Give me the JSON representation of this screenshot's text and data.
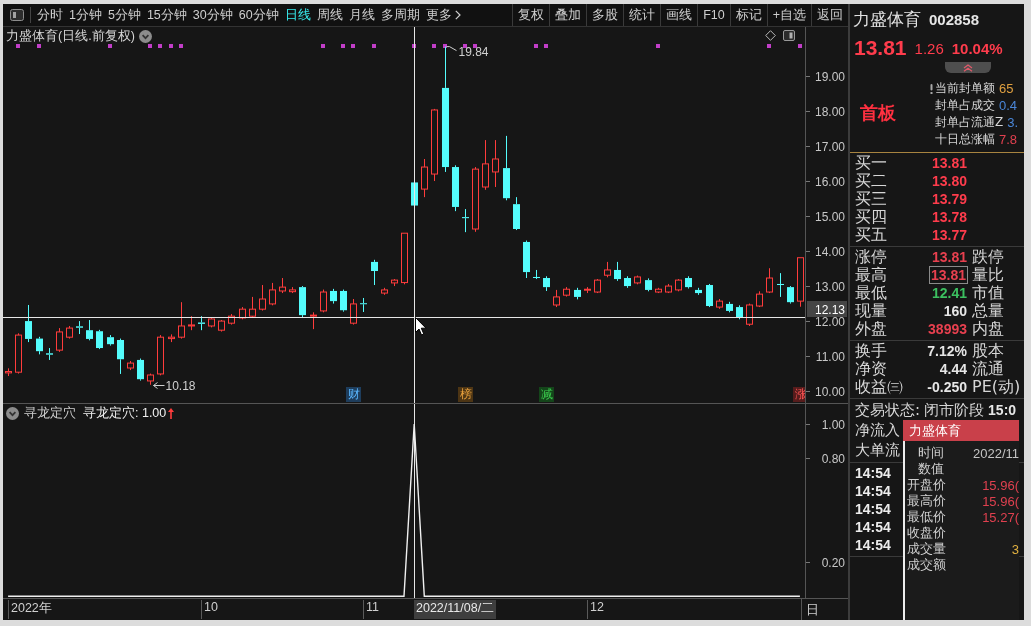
{
  "toolbar": {
    "periods": [
      {
        "label": "分时",
        "selected": false
      },
      {
        "label": "1分钟",
        "selected": false
      },
      {
        "label": "5分钟",
        "selected": false
      },
      {
        "label": "15分钟",
        "selected": false
      },
      {
        "label": "30分钟",
        "selected": false
      },
      {
        "label": "60分钟",
        "selected": false
      },
      {
        "label": "日线",
        "selected": true
      },
      {
        "label": "周线",
        "selected": false
      },
      {
        "label": "月线",
        "selected": false
      },
      {
        "label": "多周期",
        "selected": false
      }
    ],
    "more": "更多",
    "actions": [
      "复权",
      "叠加",
      "多股",
      "统计",
      "画线",
      "F10",
      "标记",
      "+自选",
      "返回"
    ]
  },
  "price_chart": {
    "title": "力盛体育(日线.前复权)",
    "chart_data": [
      {
        "type": "candlestick",
        "ylim": [
          9.66,
          20.4
        ],
        "yticks": [
          {
            "value": 19,
            "label": "19.00"
          },
          {
            "value": 18,
            "label": "18.00"
          },
          {
            "value": 17,
            "label": "17.00"
          },
          {
            "value": 16,
            "label": "16.00"
          },
          {
            "value": 15,
            "label": "15.00"
          },
          {
            "value": 14,
            "label": "14.00"
          },
          {
            "value": 13,
            "label": "13.00"
          },
          {
            "value": 12,
            "label": "12.00"
          },
          {
            "value": 11,
            "label": "11.00"
          },
          {
            "value": 10,
            "label": "10.00"
          }
        ],
        "ohlc": [
          [
            10.52,
            10.65,
            10.43,
            10.56
          ],
          [
            10.54,
            11.65,
            10.5,
            11.6
          ],
          [
            12.0,
            12.46,
            11.4,
            11.49
          ],
          [
            11.5,
            11.55,
            11.05,
            11.14
          ],
          [
            11.08,
            11.23,
            10.89,
            11.04
          ],
          [
            11.17,
            11.8,
            11.12,
            11.69
          ],
          [
            11.54,
            11.86,
            11.5,
            11.8
          ],
          [
            11.85,
            12.0,
            11.63,
            11.81
          ],
          [
            11.74,
            12.03,
            11.45,
            11.49
          ],
          [
            11.71,
            11.75,
            11.2,
            11.23
          ],
          [
            11.54,
            11.6,
            11.3,
            11.34
          ],
          [
            11.46,
            11.5,
            10.49,
            10.91
          ],
          [
            10.66,
            10.86,
            10.6,
            10.8
          ],
          [
            10.89,
            10.93,
            10.3,
            10.34
          ],
          [
            10.29,
            10.5,
            10.18,
            10.46
          ],
          [
            10.49,
            11.6,
            10.45,
            11.54
          ],
          [
            11.5,
            11.62,
            11.4,
            11.54
          ],
          [
            11.54,
            12.54,
            11.5,
            11.86
          ],
          [
            11.86,
            12.14,
            11.74,
            11.89
          ],
          [
            11.96,
            12.14,
            11.74,
            11.92
          ],
          [
            11.86,
            12.1,
            11.82,
            12.06
          ],
          [
            11.74,
            12.03,
            11.7,
            12.0
          ],
          [
            11.94,
            12.2,
            11.9,
            12.14
          ],
          [
            12.09,
            12.4,
            12.05,
            12.34
          ],
          [
            12.14,
            12.69,
            12.1,
            12.34
          ],
          [
            12.34,
            13.03,
            12.3,
            12.63
          ],
          [
            12.49,
            13.09,
            12.45,
            12.89
          ],
          [
            12.86,
            13.23,
            12.8,
            12.97
          ],
          [
            12.84,
            12.97,
            12.8,
            12.89
          ],
          [
            12.97,
            13.0,
            12.1,
            12.17
          ],
          [
            12.15,
            12.25,
            11.77,
            12.17
          ],
          [
            12.29,
            12.9,
            12.25,
            12.83
          ],
          [
            12.86,
            12.92,
            12.5,
            12.57
          ],
          [
            12.86,
            12.9,
            12.27,
            12.31
          ],
          [
            11.94,
            12.63,
            11.9,
            12.49
          ],
          [
            12.51,
            12.66,
            12.26,
            12.49
          ],
          [
            13.69,
            13.75,
            13.03,
            13.43
          ],
          [
            12.8,
            12.95,
            12.75,
            12.89
          ],
          [
            13.09,
            13.2,
            13.0,
            13.17
          ],
          [
            13.1,
            14.51,
            13.05,
            14.51
          ],
          [
            15.96,
            15.96,
            15.27,
            15.3
          ],
          [
            15.77,
            16.63,
            15.54,
            16.4
          ],
          [
            16.2,
            18.06,
            16.0,
            18.03
          ],
          [
            18.66,
            19.84,
            16.26,
            16.4
          ],
          [
            16.4,
            16.45,
            15.14,
            15.26
          ],
          [
            14.97,
            15.2,
            14.54,
            14.94
          ],
          [
            14.63,
            16.4,
            14.55,
            16.34
          ],
          [
            15.83,
            17.17,
            15.75,
            16.49
          ],
          [
            16.26,
            17.17,
            15.83,
            16.63
          ],
          [
            16.37,
            17.29,
            15.45,
            15.51
          ],
          [
            15.34,
            15.54,
            14.6,
            14.63
          ],
          [
            14.26,
            14.3,
            13.23,
            13.4
          ],
          [
            13.26,
            13.46,
            13.2,
            13.23
          ],
          [
            13.23,
            13.28,
            12.86,
            12.97
          ],
          [
            12.46,
            12.89,
            12.4,
            12.69
          ],
          [
            12.74,
            12.97,
            12.7,
            12.91
          ],
          [
            12.89,
            12.95,
            12.62,
            12.69
          ],
          [
            12.89,
            12.97,
            12.8,
            12.91
          ],
          [
            12.83,
            13.2,
            12.8,
            13.17
          ],
          [
            13.31,
            13.69,
            13.25,
            13.46
          ],
          [
            13.46,
            13.69,
            13.15,
            13.2
          ],
          [
            13.23,
            13.28,
            12.95,
            13.0
          ],
          [
            13.09,
            13.3,
            13.05,
            13.26
          ],
          [
            13.17,
            13.22,
            12.85,
            12.89
          ],
          [
            12.83,
            12.95,
            12.8,
            12.91
          ],
          [
            12.83,
            13.06,
            12.8,
            13.0
          ],
          [
            12.89,
            13.2,
            12.85,
            13.17
          ],
          [
            13.23,
            13.28,
            12.93,
            12.97
          ],
          [
            12.89,
            12.95,
            12.75,
            12.8
          ],
          [
            13.03,
            13.06,
            12.4,
            12.43
          ],
          [
            12.4,
            12.63,
            12.35,
            12.57
          ],
          [
            12.49,
            12.55,
            12.25,
            12.29
          ],
          [
            12.4,
            12.45,
            12.05,
            12.11
          ],
          [
            11.91,
            12.5,
            11.86,
            12.46
          ],
          [
            12.43,
            12.85,
            12.4,
            12.77
          ],
          [
            12.83,
            13.51,
            12.8,
            13.23
          ],
          [
            13.06,
            13.37,
            12.69,
            13.03
          ],
          [
            12.97,
            13.0,
            12.5,
            12.54
          ],
          [
            12.57,
            13.81,
            12.41,
            13.81
          ]
        ],
        "series": [
          {
            "type": "scatter",
            "marker": "square",
            "color": "#c23ec8",
            "values": [
              null,
              19.87,
              null,
              19.87,
              null,
              null,
              null,
              null,
              null,
              null,
              19.87,
              null,
              null,
              null,
              19.87,
              19.87,
              19.87,
              19.87,
              null,
              null,
              null,
              null,
              null,
              null,
              null,
              null,
              null,
              null,
              null,
              null,
              null,
              19.87,
              null,
              19.87,
              19.87,
              null,
              19.87,
              null,
              null,
              null,
              19.87,
              null,
              19.87,
              19.87,
              null,
              19.87,
              19.87,
              null,
              null,
              null,
              null,
              null,
              19.87,
              19.87,
              null,
              null,
              null,
              null,
              null,
              null,
              null,
              null,
              null,
              null,
              19.87,
              null,
              null,
              null,
              null,
              null,
              null,
              null,
              null,
              null,
              null,
              19.87,
              null,
              null,
              19.87
            ]
          }
        ],
        "annotations": [
          "19.84",
          "10.18"
        ],
        "ref_lines": [
          {
            "axis": "y",
            "value": 12.13,
            "label": "12.13"
          }
        ]
      }
    ],
    "events": [
      {
        "label": "财",
        "color": "#1e3d5c"
      },
      {
        "label": "榜",
        "color": "#4d3514"
      },
      {
        "label": "减",
        "color": "#14451a"
      },
      {
        "label": "涨",
        "color": "#561c1c"
      }
    ]
  },
  "indicator": {
    "name": "寻龙定穴",
    "reading": "寻龙定穴: 1.00",
    "chart_data": [
      {
        "type": "line",
        "ylim": [
          -0.01,
          1.116
        ],
        "yticks": [
          {
            "value": 1,
            "label": "1.00"
          },
          {
            "value": 0.8,
            "label": "0.80"
          },
          {
            "value": 0.2,
            "label": "0.20"
          }
        ],
        "values": [
          0,
          0,
          0,
          0,
          0,
          0,
          0,
          0,
          0,
          0,
          0,
          0,
          0,
          0,
          0,
          0,
          0,
          0,
          0,
          0,
          0,
          0,
          0,
          0,
          0,
          0,
          0,
          0,
          0,
          0,
          0,
          0,
          0,
          0,
          0,
          0,
          0,
          0,
          0,
          0,
          1,
          0,
          0,
          0,
          0,
          0,
          0,
          0,
          0,
          0,
          0,
          0,
          0,
          0,
          0,
          0,
          0,
          0,
          0,
          0,
          0,
          0,
          0,
          0,
          0,
          0,
          0,
          0,
          0,
          0,
          0,
          0,
          0,
          0,
          0,
          0,
          0,
          0,
          0
        ],
        "color": "#f0f0f0"
      }
    ]
  },
  "date_axis": {
    "labels": [
      "2022年",
      "10",
      "11",
      "12"
    ],
    "cursor_label": "2022/11/08/二",
    "corner": "日"
  },
  "quote_panel": {
    "name": "力盛体育",
    "code": "002858",
    "price": "13.81",
    "change": "1.26",
    "change_pct": "10.04%",
    "board": "首板",
    "seal": [
      {
        "label": "当前封单额",
        "value": "65",
        "color": "#e0a040"
      },
      {
        "label": "封单占成交",
        "value": "0.4",
        "color": "#4a86d8"
      },
      {
        "label": "封单占流通Z",
        "value": "3.",
        "color": "#4a86d8"
      },
      {
        "label": "十日总涨幅",
        "value": "7.8",
        "color": "#e0404f"
      }
    ],
    "bids": [
      {
        "label": "买一",
        "price": "13.81"
      },
      {
        "label": "买二",
        "price": "13.80"
      },
      {
        "label": "买三",
        "price": "13.79"
      },
      {
        "label": "买四",
        "price": "13.78"
      },
      {
        "label": "买五",
        "price": "13.77"
      }
    ],
    "stats": [
      {
        "label": "涨停",
        "value": "13.81",
        "color": "#e8404f",
        "label2": "跌停",
        "highlighted": false
      },
      {
        "label": "最高",
        "value": "13.81",
        "color": "#e8404f",
        "label2": "量比",
        "highlighted": true
      },
      {
        "label": "最低",
        "value": "12.41",
        "color": "#3cc060",
        "label2": "市值",
        "highlighted": false
      },
      {
        "label": "现量",
        "value": "160",
        "color": "#e6e6e6",
        "label2": "总量",
        "highlighted": false
      },
      {
        "label": "外盘",
        "value": "38993",
        "color": "#e8404f",
        "label2": "内盘",
        "highlighted": false
      }
    ],
    "fundamentals": [
      {
        "label": "换手",
        "value": "7.12%",
        "label2": "股本"
      },
      {
        "label": "净资",
        "value": "4.44",
        "label2": "流通"
      },
      {
        "label": "收益㈢",
        "value": "-0.250",
        "label2": "PE(动)"
      }
    ],
    "status": {
      "label": "交易状态:",
      "value": "闭市阶段",
      "time": "15:0"
    },
    "flows": [
      "净流入",
      "大单流"
    ],
    "trades": [
      "14:54",
      "14:54",
      "14:54",
      "14:54",
      "14:54"
    ]
  },
  "tooltip": {
    "title": "力盛体育",
    "rows": [
      {
        "kind": "head",
        "label": "时间",
        "value": "2022/11",
        "color": "#c4c4c4"
      },
      {
        "kind": "head",
        "label": "数值"
      },
      {
        "kind": "field",
        "label": "开盘价",
        "value": "15.96(",
        "color": "#e0404f"
      },
      {
        "kind": "field",
        "label": "最高价",
        "value": "15.96(",
        "color": "#e0404f"
      },
      {
        "kind": "field",
        "label": "最低价",
        "value": "15.27(",
        "color": "#e0404f"
      },
      {
        "kind": "field",
        "label": "收盘价"
      },
      {
        "kind": "field",
        "label": "成交量",
        "value": "3",
        "color": "#e0b040"
      },
      {
        "kind": "field",
        "label": "成交额"
      }
    ]
  }
}
